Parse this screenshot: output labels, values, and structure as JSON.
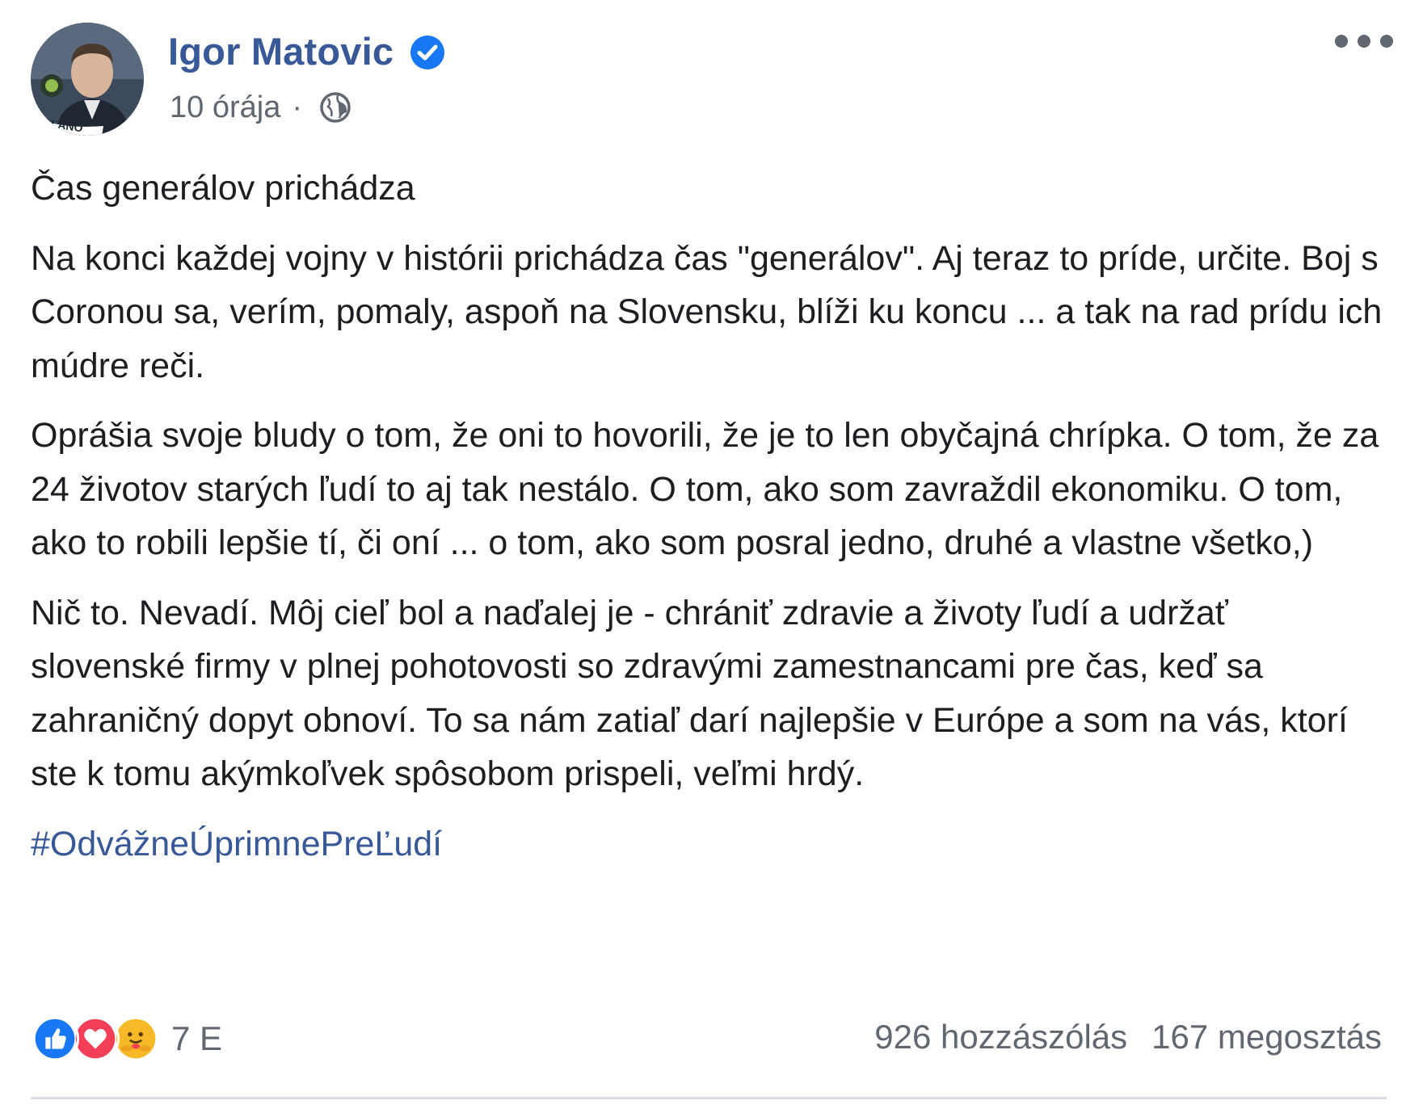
{
  "post": {
    "author": "Igor Matovic",
    "verified_icon": "verified-badge-icon",
    "timestamp": "10 órája",
    "separator": "·",
    "audience_icon": "globe-icon",
    "more_icon": "more-options-icon",
    "avatar_label": "OĽANO",
    "paragraphs": [
      "Čas generálov prichádza",
      "Na konci každej vojny v histórii prichádza čas \"generálov\". Aj teraz to príde, určite. Boj s Coronou sa, verím, pomaly, aspoň na Slovensku, blíži ku koncu ... a tak na rad prídu ich múdre reči.",
      "Oprášia svoje bludy o tom, že oni to hovorili, že je to len obyčajná chrípka. O tom, že za 24 životov starých ľudí to aj tak nestálo. O tom, ako som zavraždil ekonomiku. O tom, ako to robili lepšie tí, či oní ... o tom, ako som posral jedno, druhé a vlastne všetko,)",
      "Nič to. Nevadí. Môj cieľ bol a naďalej je - chrániť zdravie a životy ľudí a udržať slovenské firmy v plnej pohotovosti so zdravými zamestnancami pre čas, keď sa zahraničný dopyt obnoví. To sa nám zatiaľ darí najlepšie v Európe a som na vás, ktorí ste k tomu akýmkoľvek spôsobom prispeli, veľmi hrdý."
    ],
    "hashtag": "#OdvážneÚprimnePreĽudí",
    "reactions": {
      "icons": [
        "like-reaction-icon",
        "love-reaction-icon",
        "care-reaction-icon"
      ],
      "count": "7 E"
    },
    "comments": "926 hozzászólás",
    "shares": "167 megosztás"
  },
  "colors": {
    "link": "#385898",
    "text": "#1c1e21",
    "secondary": "#606770",
    "like_blue": "#1877f2",
    "love_red": "#f33e58",
    "care_yellow": "#f7b928"
  }
}
